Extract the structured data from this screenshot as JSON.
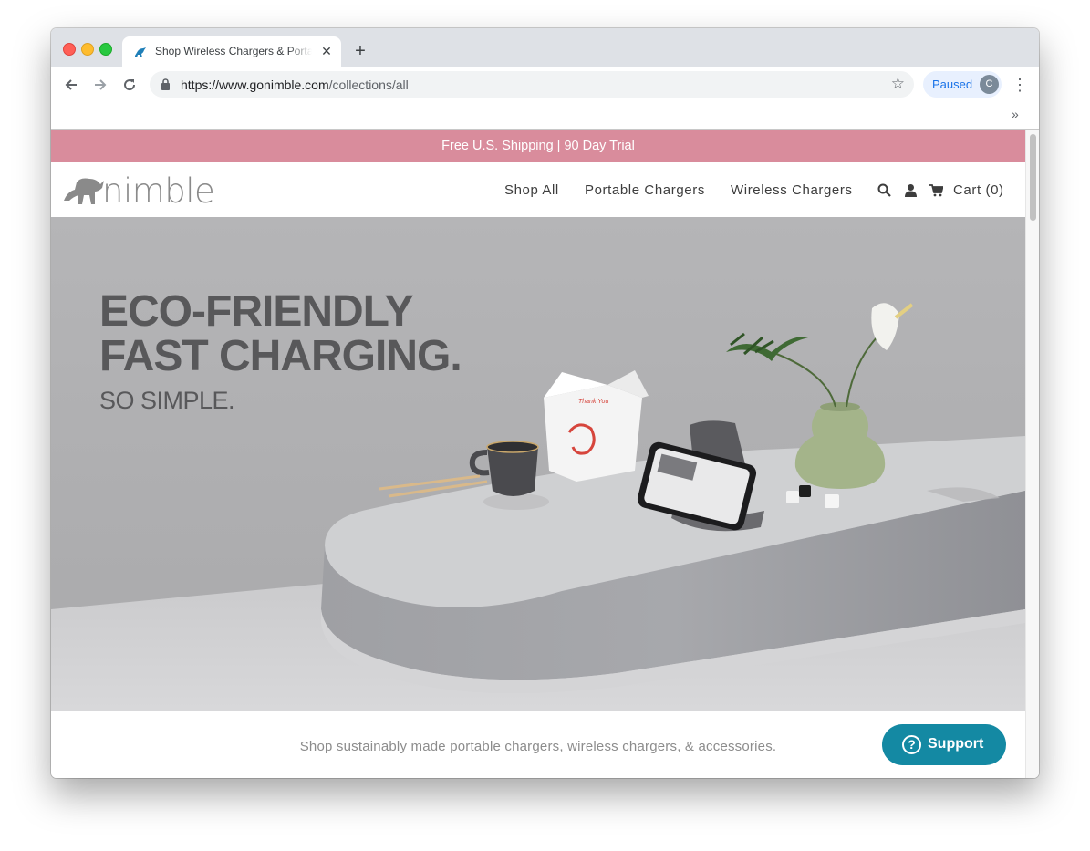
{
  "browser": {
    "tab_title": "Shop Wireless Chargers & Portable Chargers",
    "tab_close": "✕",
    "new_tab": "+",
    "url_host": "https://www.gonimble.com",
    "url_path": "/collections/all",
    "profile_label": "Paused",
    "profile_initial": "C",
    "bookmarks_overflow": "»",
    "nav_icons": [
      "back-arrow-icon",
      "forward-arrow-icon",
      "reload-icon",
      "lock-icon",
      "star-icon",
      "more-vert-icon"
    ]
  },
  "site": {
    "announcement": "Free U.S. Shipping | 90 Day Trial",
    "brand_color": "#d98c9c",
    "logo_word": "nimble",
    "nav": {
      "shop_all": "Shop All",
      "portable": "Portable Chargers",
      "wireless": "Wireless Chargers",
      "cart": "Cart (0)"
    },
    "header_icons": [
      "search-icon",
      "user-icon",
      "cart-icon"
    ],
    "hero": {
      "line1": "ECO-FRIENDLY",
      "line2": "FAST CHARGING.",
      "line3": "SO SIMPLE."
    },
    "tagline": "Shop sustainably made portable chargers, wireless chargers, & accessories.",
    "support": {
      "label": "Support",
      "icon": "?",
      "color": "#1489a3"
    }
  }
}
